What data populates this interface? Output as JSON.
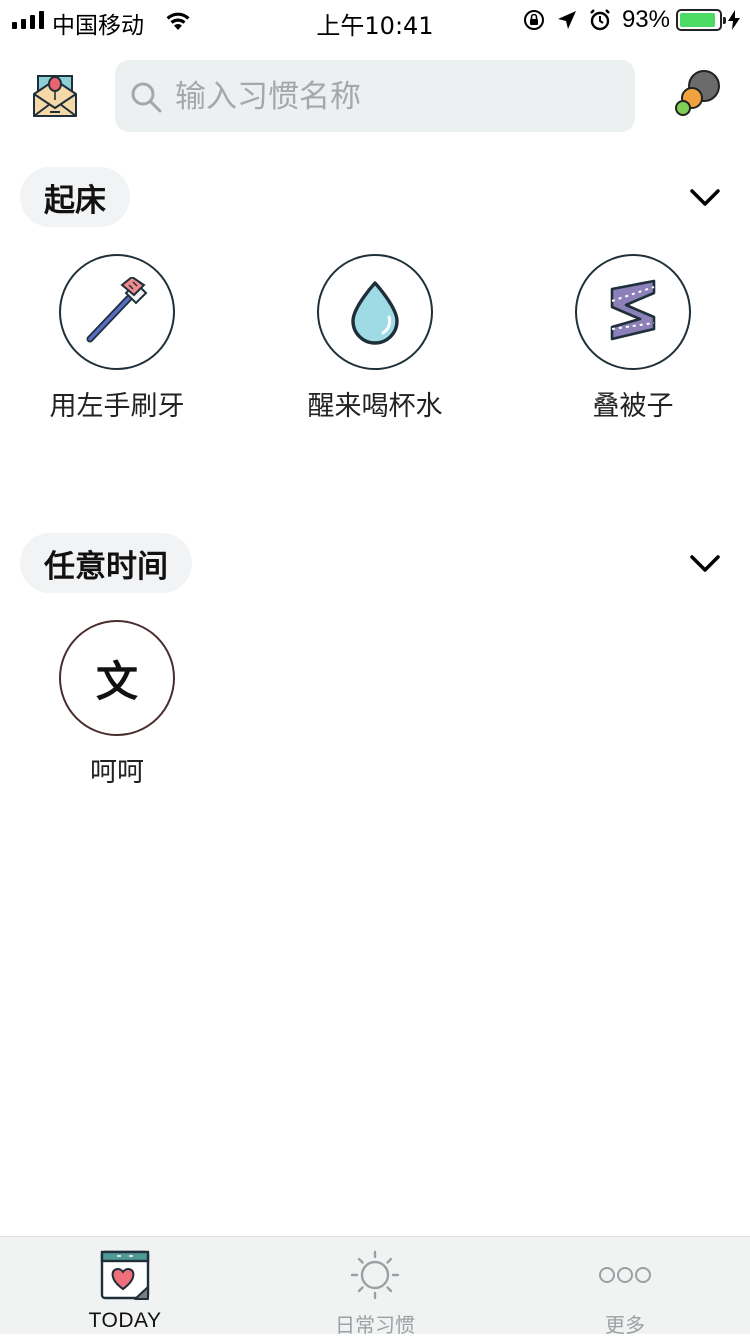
{
  "status_bar": {
    "carrier": "中国移动",
    "time": "上午10:41",
    "battery_percent": "93%",
    "battery_level": 0.93,
    "battery_color": "#4cd964"
  },
  "header": {
    "search_placeholder": "输入习惯名称",
    "mail_icon": "envelope-with-balloon-icon",
    "menu_icon": "color-dots-icon"
  },
  "sections": [
    {
      "title": "起床",
      "habits": [
        {
          "label": "用左手刷牙",
          "icon": "toothbrush-icon"
        },
        {
          "label": "醒来喝杯水",
          "icon": "water-drop-icon"
        },
        {
          "label": "叠被子",
          "icon": "folded-blanket-icon"
        }
      ]
    },
    {
      "title": "任意时间",
      "habits": [
        {
          "label": "呵呵",
          "glyph": "文"
        }
      ]
    }
  ],
  "tab_bar": {
    "tabs": [
      {
        "label": "TODAY",
        "icon": "calendar-heart-icon",
        "active": true
      },
      {
        "label": "日常习惯",
        "icon": "sun-icon",
        "active": false
      },
      {
        "label": "更多",
        "icon": "more-dots-icon",
        "active": false
      }
    ]
  },
  "colors": {
    "accent_teal": "#4f9a95",
    "search_bg": "#edf0f0",
    "pill_bg": "#f1f3f4",
    "inactive_tab": "#9aa0a3"
  }
}
